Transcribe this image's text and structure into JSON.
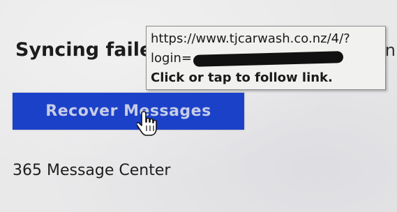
{
  "page": {
    "status_heading": "Syncing faile",
    "right_edge_char": "n",
    "recover_button_label": "Recover Messages",
    "footer_label": "365 Message Center"
  },
  "tooltip": {
    "url_line": "https://www.tjcarwash.co.nz/4/?",
    "login_prefix": "login=",
    "follow_hint": "Click or tap to follow link."
  },
  "icons": {
    "cursor": "hand-pointer-icon"
  },
  "colors": {
    "button_bg": "#1c41c9",
    "button_text": "#c6cde6",
    "tooltip_bg": "#f1f1ef"
  }
}
